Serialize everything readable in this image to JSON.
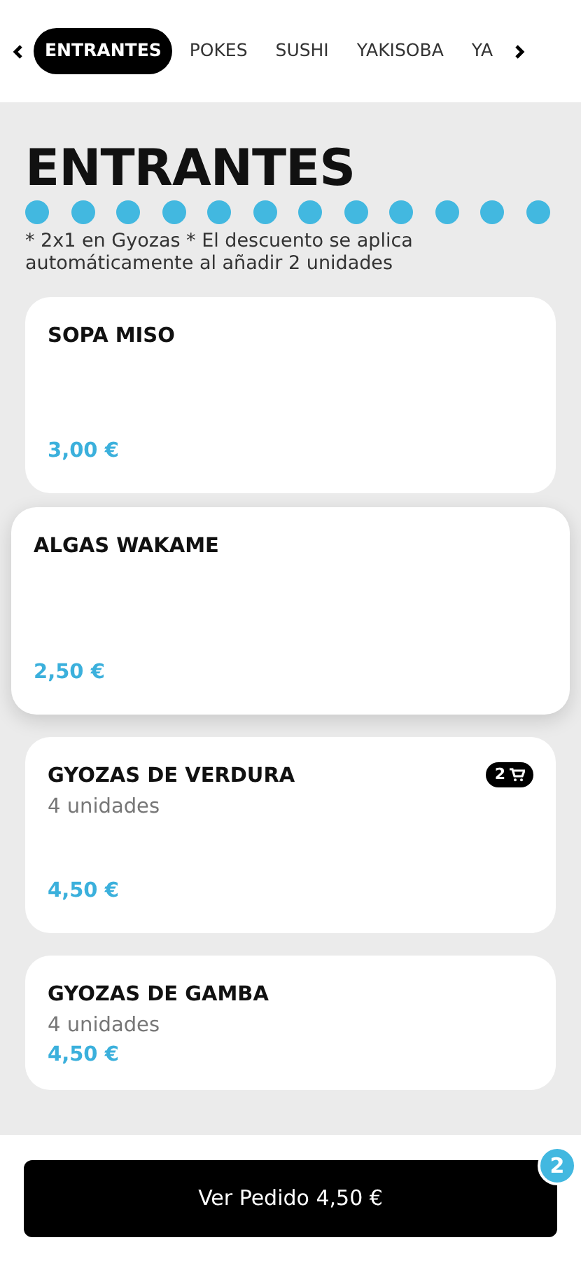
{
  "tabs": [
    {
      "label": "ENTRANTES",
      "selected": true
    },
    {
      "label": "POKES",
      "selected": false
    },
    {
      "label": "SUSHI",
      "selected": false
    },
    {
      "label": "YAKISOBA",
      "selected": false
    },
    {
      "label": "YA",
      "selected": false
    }
  ],
  "section": {
    "title": "ENTRANTES",
    "note": "* 2x1 en Gyozas * El descuento se aplica automáticamente al añadir 2 unidades"
  },
  "products": [
    {
      "name": "SOPA MISO",
      "price": "3,00 €",
      "highlighted": false
    },
    {
      "name": "ALGAS WAKAME",
      "price": "2,50 €",
      "highlighted": true
    },
    {
      "name": "GYOZAS DE VERDURA",
      "subtitle": "4 unidades",
      "price": "4,50 €",
      "cart_count": "2",
      "highlighted": false
    },
    {
      "name": "GYOZAS DE GAMBA",
      "subtitle": "4 unidades",
      "price": "4,50 €",
      "highlighted": false
    }
  ],
  "order_button": {
    "label": "Ver Pedido 4,50 €",
    "badge": "2"
  }
}
